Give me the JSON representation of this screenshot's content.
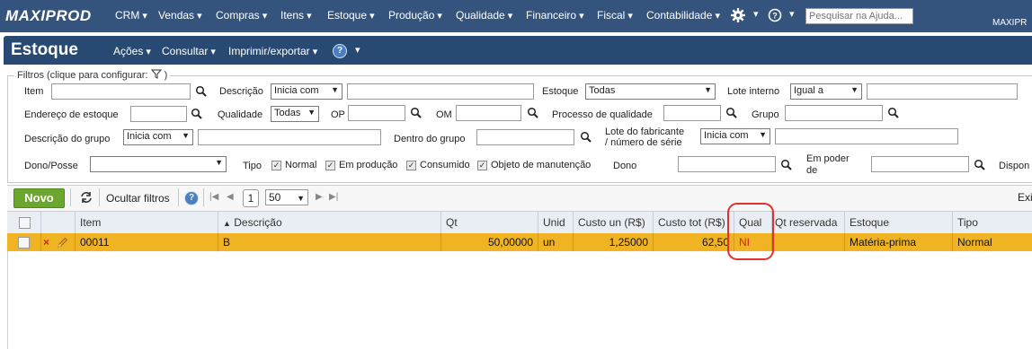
{
  "app": {
    "logo": "MAXIPROD",
    "nav": [
      "CRM",
      "Vendas",
      "Compras",
      "Itens",
      "Estoque",
      "Produção",
      "Qualidade",
      "Financeiro",
      "Fiscal",
      "Contabilidade"
    ],
    "search_placeholder": "Pesquisar na Ajuda...",
    "user": "MAXIPR"
  },
  "module": {
    "title": "Estoque",
    "menus": [
      "Ações",
      "Consultar",
      "Imprimir/exportar"
    ]
  },
  "filters": {
    "legend": "Filtros (clique para configurar:",
    "legend_close": ")",
    "item": "Item",
    "descricao": "Descrição",
    "descricao_op": "Inicia com",
    "estoque": "Estoque",
    "estoque_value": "Todas",
    "lote_interno": "Lote interno",
    "lote_interno_op": "Igual a",
    "endereco": "Endereço de estoque",
    "qualidade": "Qualidade",
    "qualidade_value": "Todas",
    "op": "OP",
    "om": "OM",
    "processo": "Processo de qualidade",
    "grupo": "Grupo",
    "descricao_grupo": "Descrição do grupo",
    "descricao_grupo_op": "Inicia com",
    "dentro_grupo": "Dentro do grupo",
    "lote_fabricante_1": "Lote do fabricante",
    "lote_fabricante_2": "/ número de série",
    "lote_fabricante_op": "Inicia com",
    "dono_posse": "Dono/Posse",
    "tipo": "Tipo",
    "tipo_options": [
      "Normal",
      "Em produção",
      "Consumido",
      "Objeto de manutenção"
    ],
    "dono": "Dono",
    "em_poder_1": "Em poder",
    "em_poder_2": "de",
    "dispon": "Dispon"
  },
  "toolbar": {
    "novo": "Novo",
    "ocultar_filtros": "Ocultar filtros",
    "page": "1",
    "page_size": "50",
    "right_label": "Exi"
  },
  "grid": {
    "columns": [
      "Item",
      "Descrição",
      "Qt",
      "Unid",
      "Custo un (R$)",
      "Custo tot (R$)",
      "Qual",
      "Qt reservada",
      "Estoque",
      "Tipo"
    ],
    "rows": [
      {
        "item": "00011",
        "descricao": "B",
        "qt": "50,00000",
        "unid": "un",
        "custo_un": "1,25000",
        "custo_tot": "62,50",
        "qual": "NI",
        "qt_reservada": "",
        "estoque": "Matéria-prima",
        "tipo": "Normal"
      }
    ]
  },
  "colors": {
    "nav_bg": "#35547d",
    "module_bg": "#284971",
    "selected_row": "#f0b323",
    "novo_button": "#6aa72c",
    "highlight": "#e0312f",
    "qual_text": "#d3201b"
  },
  "icons": [
    "gear-icon",
    "help-icon",
    "search-icon",
    "filter-icon",
    "refresh-icon",
    "delete-icon",
    "edit-icon",
    "first-page-icon",
    "prev-page-icon",
    "next-page-icon",
    "last-page-icon"
  ]
}
